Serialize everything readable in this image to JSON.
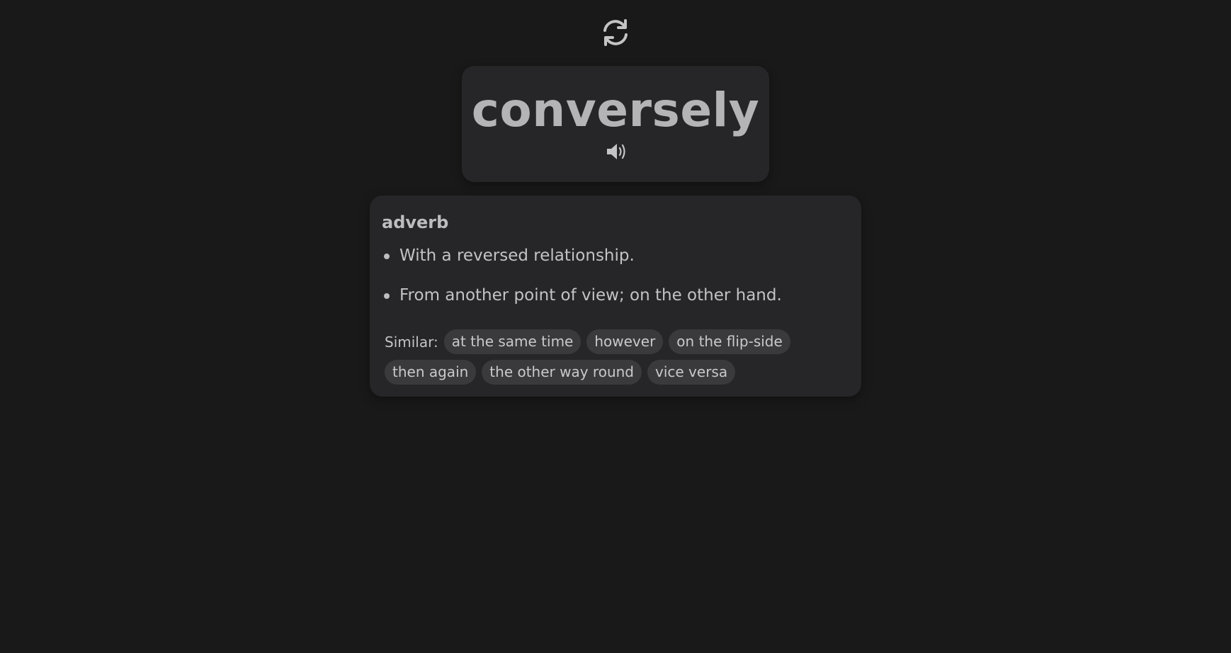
{
  "header": {
    "refresh_icon": "refresh-icon"
  },
  "word_card": {
    "word": "conversely",
    "speaker_icon": "speaker-icon"
  },
  "definition_card": {
    "part_of_speech": "adverb",
    "definitions": [
      "With a reversed relationship.",
      "From another point of view; on the other hand."
    ],
    "similar_label": "Similar:",
    "similar": [
      "at the same time",
      "however",
      "on the flip-side",
      "then again",
      "the other way round",
      "vice versa"
    ]
  },
  "colors": {
    "background": "#191919",
    "card": "#262628",
    "chip": "#3a3a3d",
    "text": "#c3c3c5",
    "word": "#b4b4b6"
  }
}
